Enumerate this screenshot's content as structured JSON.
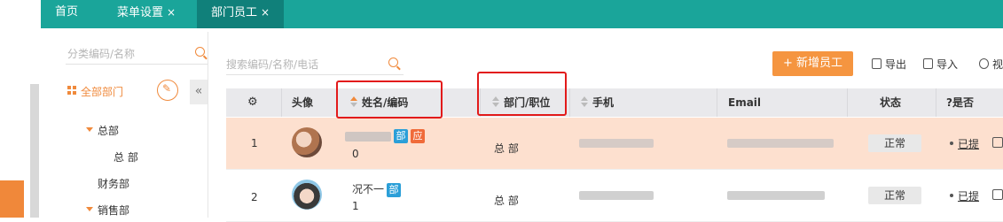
{
  "tabs": [
    {
      "label": "首页"
    },
    {
      "label": "菜单设置",
      "close": "×"
    },
    {
      "label": "部门员工",
      "close": "×"
    }
  ],
  "sidebar": {
    "search_placeholder": "分类编码/名称",
    "root_label": "全部部门",
    "collapse_label": "«",
    "tree": [
      {
        "label": "总部"
      },
      {
        "label": "总 部"
      },
      {
        "label": "财务部"
      },
      {
        "label": "销售部"
      }
    ]
  },
  "toolbar": {
    "search_placeholder": "搜索编码/名称/电话",
    "add_label": "+ 新增员工",
    "export_label": "导出",
    "import_label": "导入",
    "view_label": "视"
  },
  "table": {
    "headers": {
      "gear": "",
      "avatar": "头像",
      "name": "姓名/编码",
      "dept": "部门/职位",
      "phone": "手机",
      "email": "Email",
      "status": "状态",
      "more": "?是否"
    },
    "rows": [
      {
        "index": "1",
        "name": "",
        "code": "0",
        "tag1": "部",
        "tag2": "应",
        "dept": "总 部",
        "status": "正常",
        "action": "已提"
      },
      {
        "index": "2",
        "name": "况不一",
        "code": "1",
        "tag1": "部",
        "dept": "总 部",
        "status": "正常",
        "action": "已提"
      }
    ]
  },
  "colors": {
    "tabbar": "#1aa59a",
    "accent": "#f08a3c",
    "highlight_row": "#fde0cf",
    "annotation": "#e21a1a"
  },
  "icons": [
    "search-icon",
    "edit-icon",
    "gear-icon",
    "sort-icon",
    "export-icon",
    "import-icon",
    "view-icon",
    "pen-icon"
  ]
}
